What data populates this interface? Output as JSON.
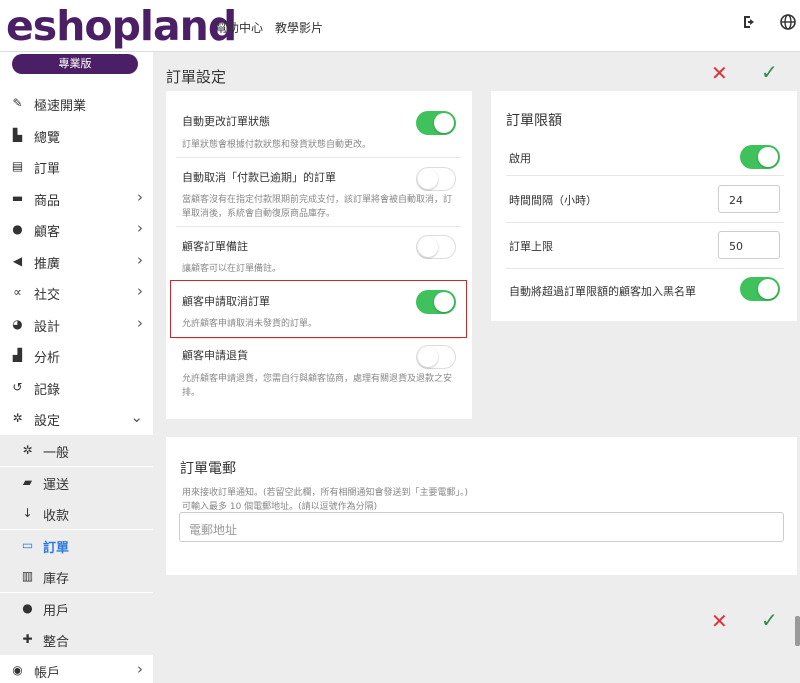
{
  "header": {
    "logo": "eshopland",
    "links": [
      "幫助中心",
      "教學影片"
    ],
    "icons": [
      "logout-icon",
      "globe-icon"
    ]
  },
  "sidebar": {
    "plan": "專業版",
    "items": [
      {
        "label": "極速開業",
        "icon": "wand-icon",
        "chevron": false
      },
      {
        "label": "總覽",
        "icon": "dashboard-icon",
        "chevron": false
      },
      {
        "label": "訂單",
        "icon": "file-dollar-icon",
        "chevron": false
      },
      {
        "label": "商品",
        "icon": "box-icon",
        "chevron": true
      },
      {
        "label": "顧客",
        "icon": "user-icon",
        "chevron": true
      },
      {
        "label": "推廣",
        "icon": "megaphone-icon",
        "chevron": true
      },
      {
        "label": "社交",
        "icon": "share-icon",
        "chevron": true
      },
      {
        "label": "設計",
        "icon": "palette-icon",
        "chevron": true
      },
      {
        "label": "分析",
        "icon": "chart-icon",
        "chevron": false
      },
      {
        "label": "記錄",
        "icon": "history-icon",
        "chevron": false
      },
      {
        "label": "設定",
        "icon": "gears-icon",
        "chevron": "down"
      }
    ],
    "subitems": [
      {
        "label": "一般",
        "icon": "gear-icon"
      },
      {
        "label": "運送",
        "icon": "truck-icon"
      },
      {
        "label": "收款",
        "icon": "hand-money-icon"
      },
      {
        "label": "訂單",
        "icon": "money-bill-icon",
        "active": true
      },
      {
        "label": "庫存",
        "icon": "warehouse-icon"
      },
      {
        "label": "用戶",
        "icon": "user-icon"
      },
      {
        "label": "整合",
        "icon": "puzzle-icon"
      }
    ],
    "account": {
      "label": "帳戶",
      "icon": "user-circle-icon"
    }
  },
  "page": {
    "title": "訂單設定"
  },
  "order_settings": [
    {
      "title": "自動更改訂單狀態",
      "desc": "訂單狀態會根據付款狀態和發貨狀態自動更改。",
      "on": true
    },
    {
      "title": "自動取消「付款已逾期」的訂單",
      "desc": "當顧客沒有在指定付款限期前完成支付，該訂單將會被自動取消，訂單取消後，系統會自動復原商品庫存。",
      "on": false
    },
    {
      "title": "顧客訂單備註",
      "desc": "讓顧客可以在訂單備註。",
      "on": false
    },
    {
      "title": "顧客申請取消訂單",
      "desc": "允許顧客申請取消未發貨的訂單。",
      "on": true
    },
    {
      "title": "顧客申請退貨",
      "desc": "允許顧客申請退貨，您需自行與顧客協商，處理有關退貨及退款之安排。",
      "on": false
    }
  ],
  "order_limit": {
    "title": "訂單限額",
    "enable_label": "啟用",
    "enable_on": true,
    "interval_label": "時間間隔（小時）",
    "interval_value": "24",
    "max_label": "訂單上限",
    "max_value": "50",
    "blacklist_label": "自動將超過訂單限額的顧客加入黑名單",
    "blacklist_on": true
  },
  "order_email": {
    "title": "訂單電郵",
    "desc1": "用來接收訂單通知。(若留空此欄，所有相關通知會發送到「主要電郵」。)",
    "desc2": "可輸入最多 10 個電郵地址。(請以逗號作為分隔)",
    "placeholder": "電郵地址"
  },
  "colors": {
    "accent": "#4b1f66",
    "toggle_on": "#3fc15c",
    "cancel": "#d9333f",
    "confirm": "#2e8b4a",
    "active_link": "#2f7bd9",
    "highlight": "#c92b2b"
  }
}
